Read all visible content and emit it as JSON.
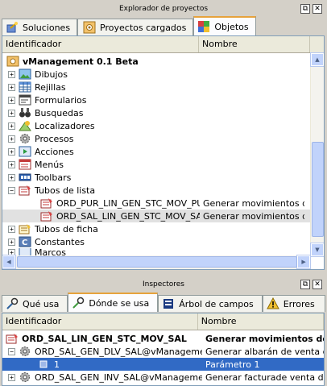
{
  "explorer": {
    "title": "Explorador de proyectos",
    "tabs": [
      {
        "label": "Soluciones"
      },
      {
        "label": "Proyectos cargados"
      },
      {
        "label": "Objetos"
      }
    ],
    "columns": [
      "Identificador",
      "Nombre"
    ],
    "root": "vManagement 0.1 Beta",
    "items": [
      {
        "label": "Dibujos",
        "icon": "image-icon"
      },
      {
        "label": "Rejillas",
        "icon": "grid-icon"
      },
      {
        "label": "Formularios",
        "icon": "form-icon"
      },
      {
        "label": "Busquedas",
        "icon": "binoculars-icon"
      },
      {
        "label": "Localizadores",
        "icon": "locator-icon"
      },
      {
        "label": "Procesos",
        "icon": "gear-icon"
      },
      {
        "label": "Acciones",
        "icon": "play-icon"
      },
      {
        "label": "Menús",
        "icon": "menu-icon"
      },
      {
        "label": "Toolbars",
        "icon": "toolbar-icon"
      },
      {
        "label": "Tubos de lista",
        "icon": "list-pipe-icon"
      },
      {
        "label": "ORD_PUR_LIN_GEN_STC_MOV_PUR",
        "name": "Generar movimientos de al",
        "icon": "list-pipe-icon"
      },
      {
        "label": "ORD_SAL_LIN_GEN_STC_MOV_SAL",
        "name": "Generar movimientos de al",
        "icon": "list-pipe-icon"
      },
      {
        "label": "Tubos de ficha",
        "icon": "record-pipe-icon"
      },
      {
        "label": "Constantes",
        "icon": "constant-icon"
      },
      {
        "label": "Marcos",
        "icon": "frame-icon"
      }
    ]
  },
  "inspectors": {
    "title": "Inspectores",
    "tabs": [
      {
        "label": "Qué usa"
      },
      {
        "label": "Dónde se usa"
      },
      {
        "label": "Árbol de campos"
      },
      {
        "label": "Errores"
      }
    ],
    "columns": [
      "Identificador",
      "Nombre"
    ],
    "rows": [
      {
        "id": "ORD_SAL_LIN_GEN_STC_MOV_SAL",
        "name": "Generar movimientos de"
      },
      {
        "id": "ORD_SAL_GEN_DLV_SAL@vManagement",
        "name": "Generar albarán de venta des"
      },
      {
        "id": "1",
        "name": "Parámetro 1"
      },
      {
        "id": "ORD_SAL_GEN_INV_SAL@vManagement",
        "name": "Generar facturade venta desc"
      }
    ]
  },
  "window_buttons": {
    "restore": "⧉",
    "close": "✕"
  },
  "colors": {
    "accent": "#e6a23c",
    "selection": "#316ac5",
    "header": "#ebeadb"
  }
}
